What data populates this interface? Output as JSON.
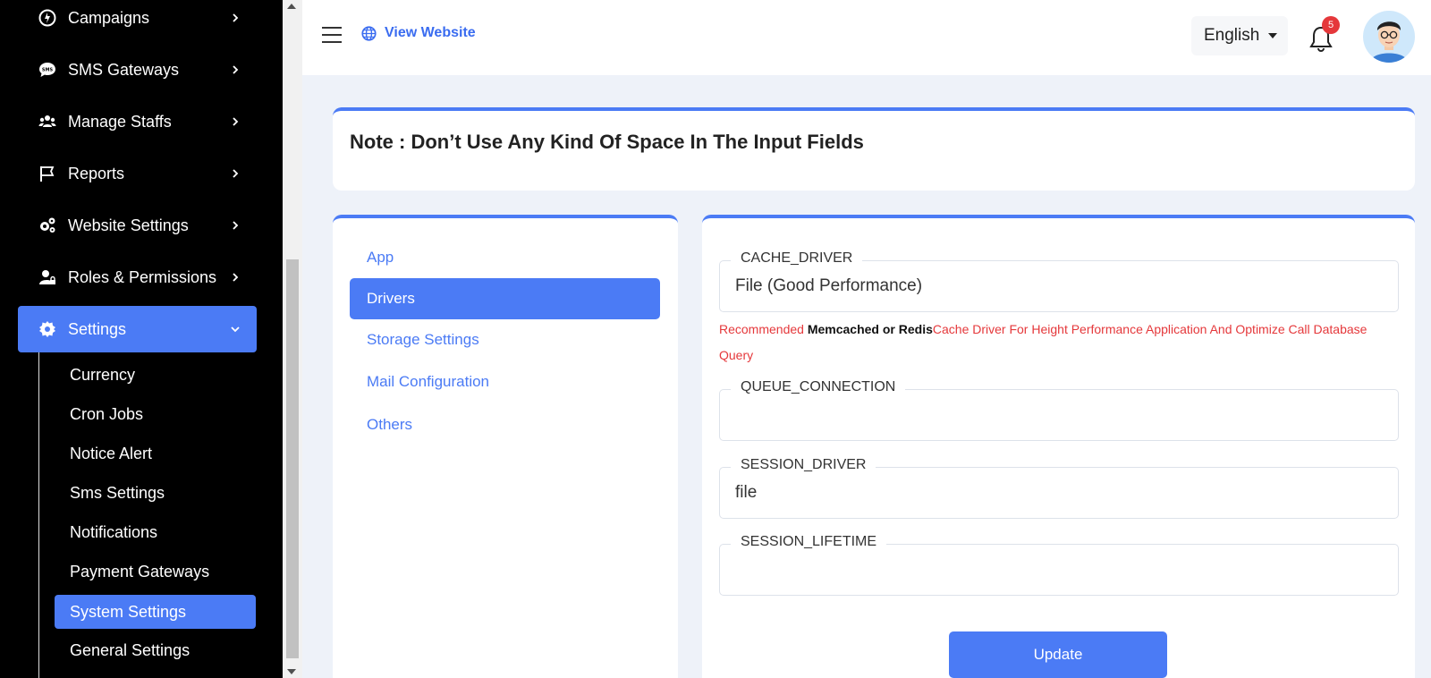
{
  "sidebar": {
    "items": [
      {
        "label": "Campaigns",
        "icon": "campaign-icon"
      },
      {
        "label": "SMS Gateways",
        "icon": "sms-icon"
      },
      {
        "label": "Manage Staffs",
        "icon": "users-icon"
      },
      {
        "label": "Reports",
        "icon": "flag-icon"
      },
      {
        "label": "Website Settings",
        "icon": "gears-icon"
      },
      {
        "label": "Roles & Permissions",
        "icon": "user-lock-icon"
      },
      {
        "label": "Settings",
        "icon": "gear-icon"
      }
    ],
    "subitems": [
      {
        "label": "Currency"
      },
      {
        "label": "Cron Jobs"
      },
      {
        "label": "Notice Alert"
      },
      {
        "label": "Sms Settings"
      },
      {
        "label": "Notifications"
      },
      {
        "label": "Payment Gateways"
      },
      {
        "label": "System Settings"
      },
      {
        "label": "General Settings"
      }
    ]
  },
  "header": {
    "view_website": "View Website",
    "language": "English",
    "notification_count": "5"
  },
  "note": {
    "text": "Note : Don’t Use Any Kind Of Space In The Input Fields"
  },
  "tabs": [
    {
      "label": "App"
    },
    {
      "label": "Drivers"
    },
    {
      "label": "Storage Settings"
    },
    {
      "label": "Mail Configuration"
    },
    {
      "label": "Others"
    }
  ],
  "form": {
    "cache_driver": {
      "label": "CACHE_DRIVER",
      "value": "File (Good Performance)"
    },
    "hint": {
      "prefix": "Recommended ",
      "strong": "Memcached or Redis",
      "suffix": "Cache Driver For Height Performance Application And Optimize Call Database Query"
    },
    "queue_connection": {
      "label": "QUEUE_CONNECTION",
      "value": ""
    },
    "session_driver": {
      "label": "SESSION_DRIVER",
      "value": "file"
    },
    "session_lifetime": {
      "label": "SESSION_LIFETIME",
      "value": ""
    },
    "update_label": "Update"
  },
  "colors": {
    "accent": "#4b7bf5",
    "danger": "#e5383b",
    "sidebar_bg": "#000000"
  }
}
